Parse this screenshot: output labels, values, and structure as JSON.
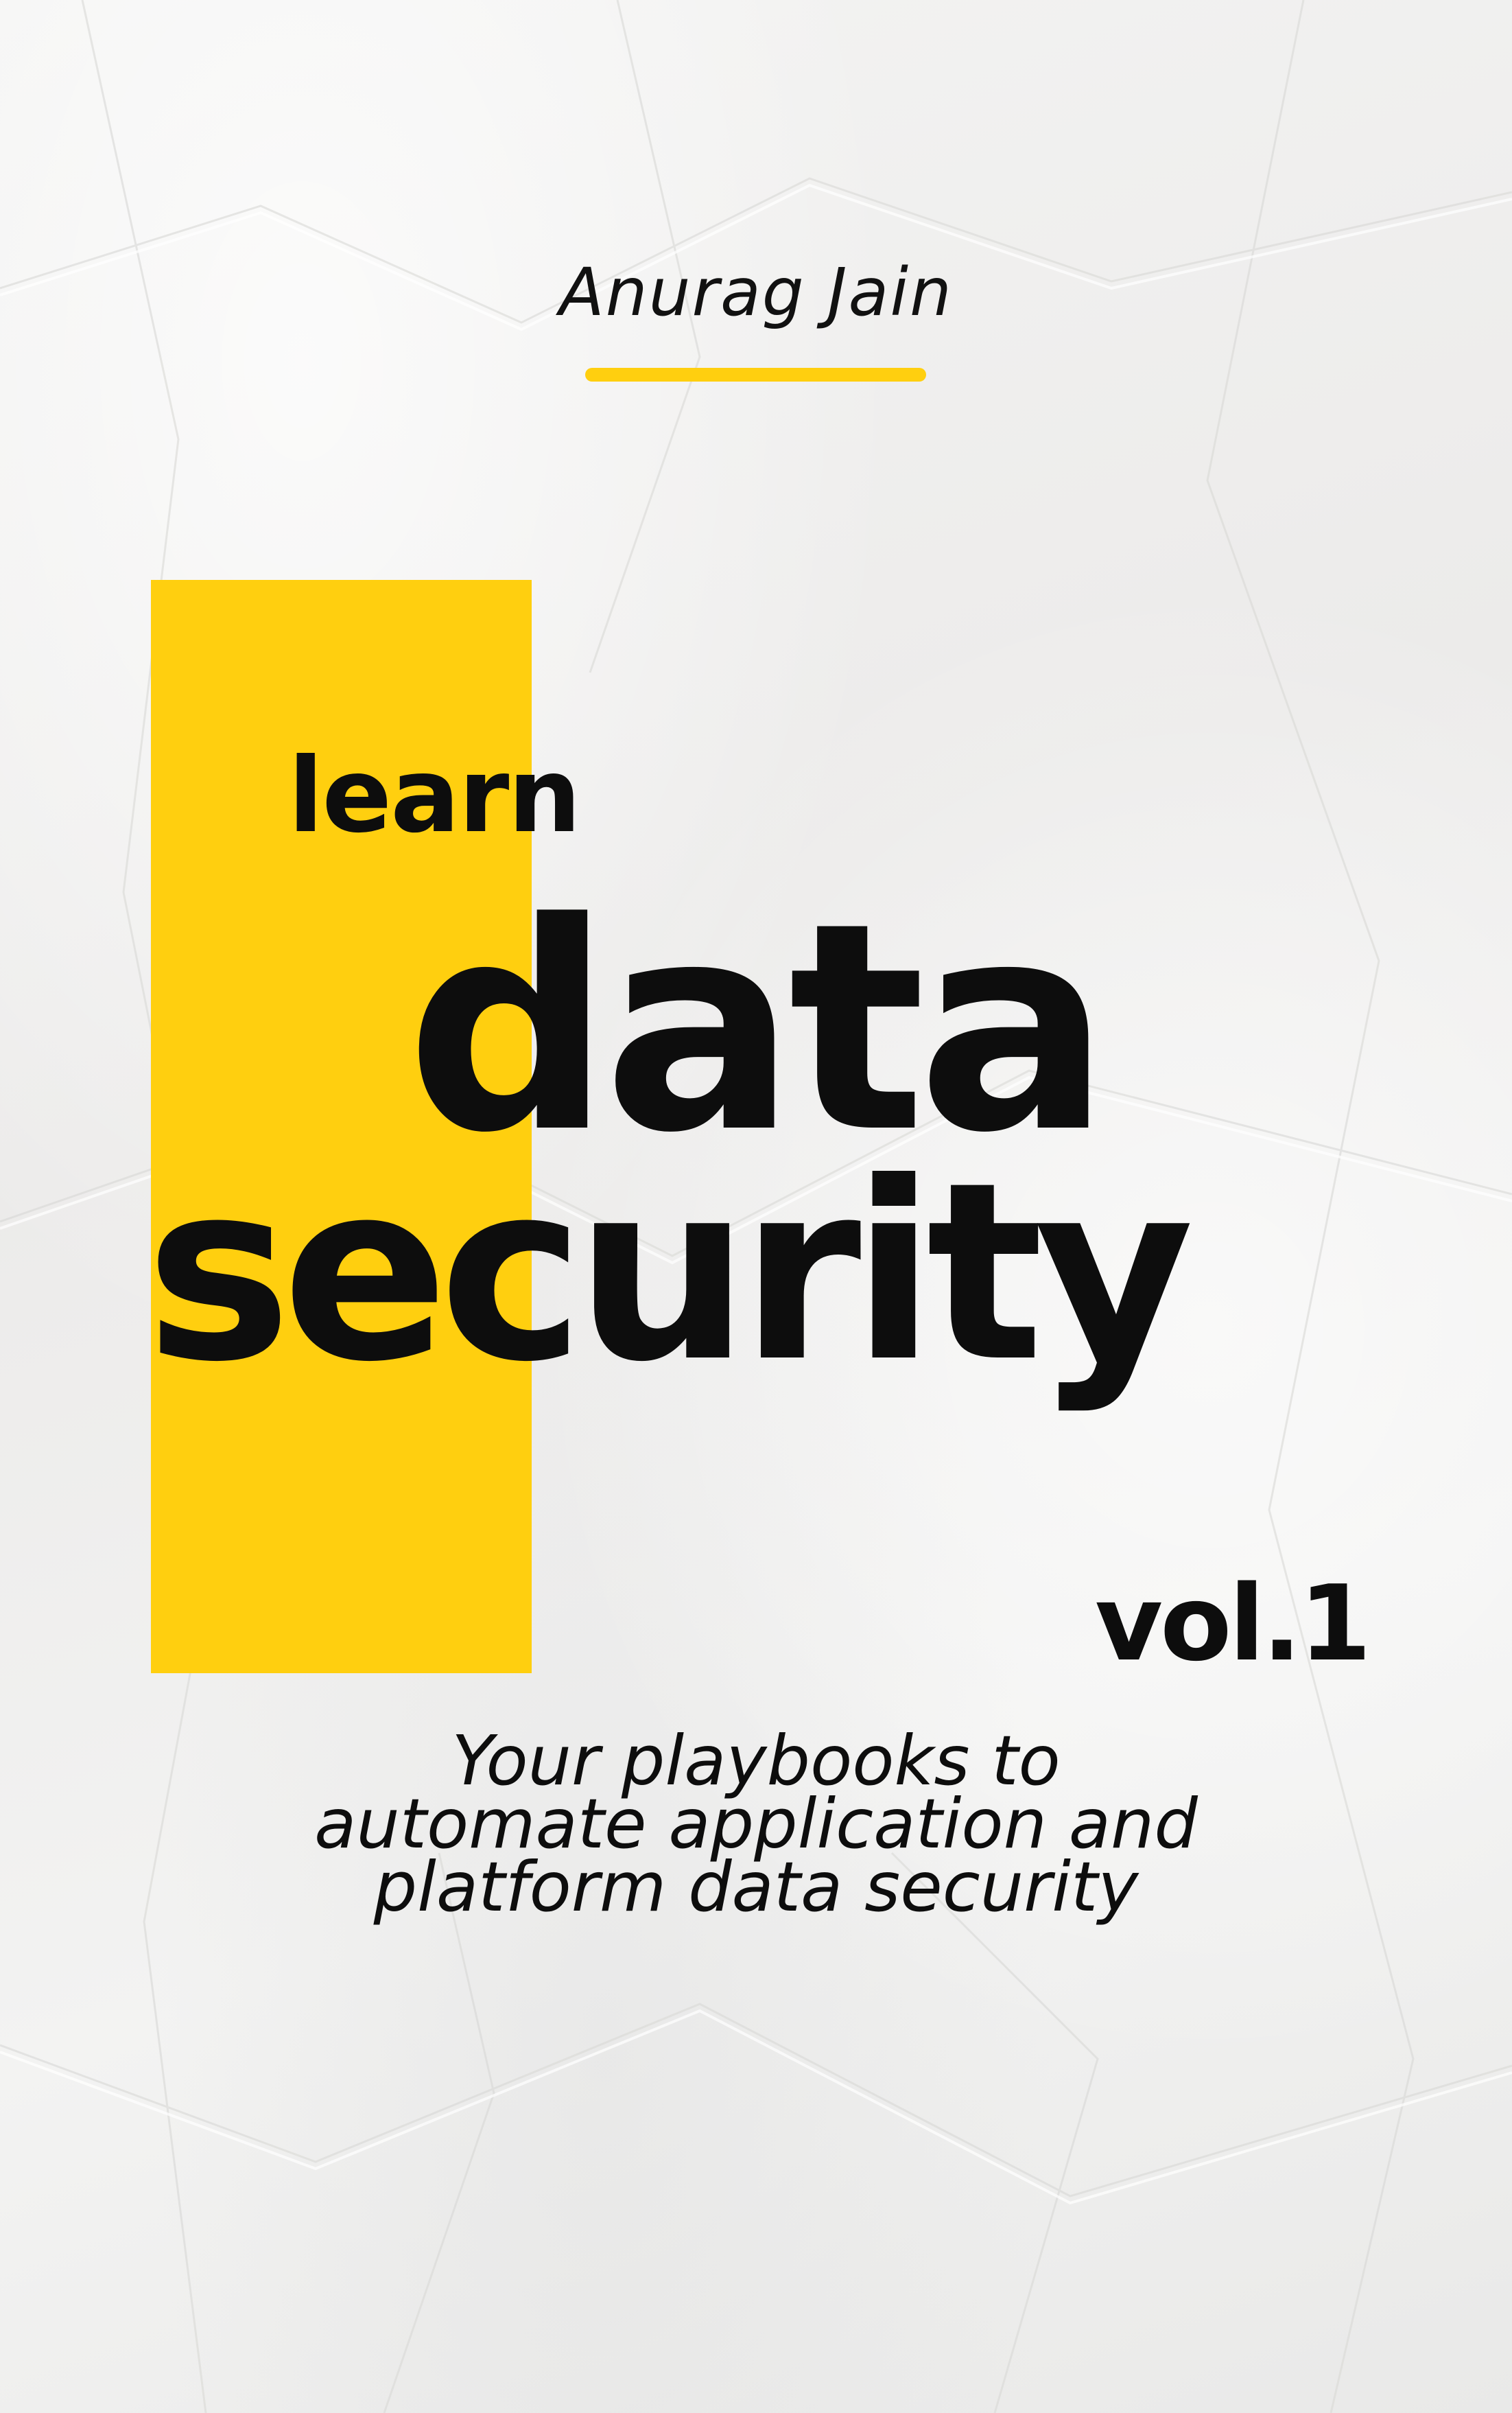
{
  "cover": {
    "author": "Anurag Jain",
    "title_prefix": "learn",
    "title_line1": "data",
    "title_line2": "security",
    "volume": "vol.1",
    "tagline": [
      "Your playbooks to",
      "automate application and",
      "platform data security"
    ]
  },
  "colors": {
    "accent_yellow": "#ffcf0f",
    "text": "#0d0d0d",
    "paper": "#f2f2f1"
  }
}
